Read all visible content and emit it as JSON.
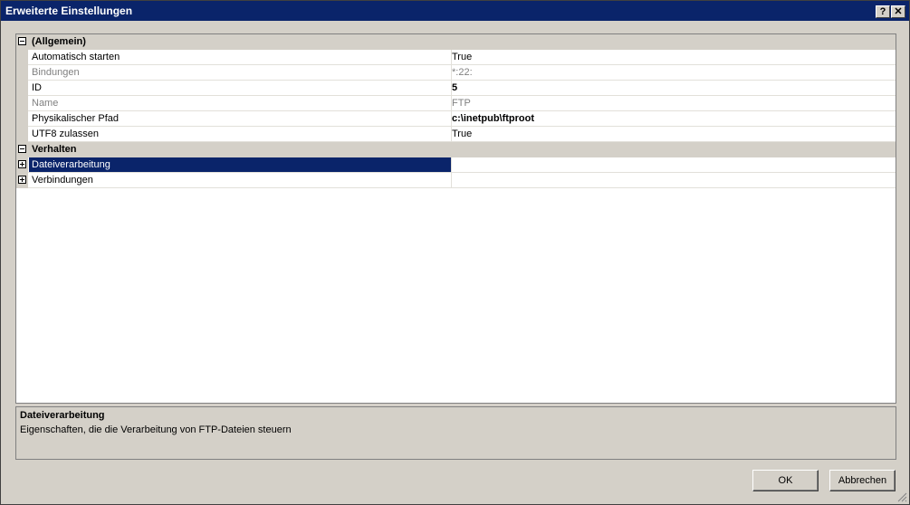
{
  "window": {
    "title": "Erweiterte Einstellungen",
    "help_label": "?",
    "close_label": "✕"
  },
  "grid": {
    "categories": [
      {
        "name": "(Allgemein)",
        "expanded": true,
        "properties": [
          {
            "name": "Automatisch starten",
            "value": "True"
          },
          {
            "name": "Bindungen",
            "value": "*:22:"
          },
          {
            "name": "ID",
            "value": "5"
          },
          {
            "name": "Name",
            "value": "FTP"
          },
          {
            "name": "Physikalischer Pfad",
            "value": "c:\\inetpub\\ftproot"
          },
          {
            "name": "UTF8 zulassen",
            "value": "True"
          }
        ]
      },
      {
        "name": "Verhalten",
        "expanded": true,
        "properties": [
          {
            "name": "Dateiverarbeitung",
            "value": ""
          },
          {
            "name": "Verbindungen",
            "value": ""
          }
        ]
      }
    ]
  },
  "description": {
    "title": "Dateiverarbeitung",
    "text": "Eigenschaften, die die Verarbeitung von FTP-Dateien steuern"
  },
  "buttons": {
    "ok": "OK",
    "cancel": "Abbrechen"
  },
  "colors": {
    "titlebar": "#0a246a",
    "face": "#d4d0c8",
    "selection": "#0a246a",
    "readonly_text": "#808080"
  }
}
